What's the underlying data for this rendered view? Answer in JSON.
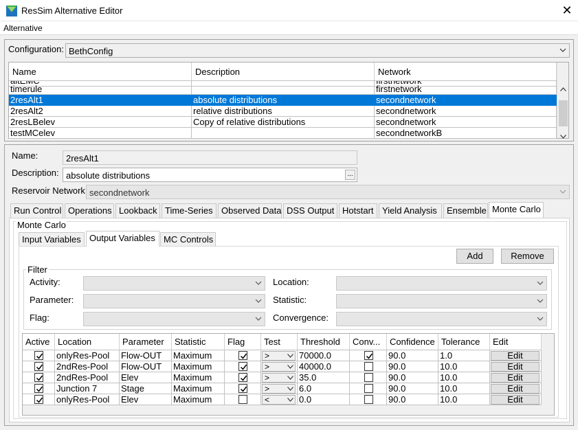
{
  "window": {
    "title": "ResSim Alternative Editor"
  },
  "menu": {
    "items": [
      "Alternative"
    ]
  },
  "configuration": {
    "label": "Configuration:",
    "value": "BethConfig"
  },
  "alt_table": {
    "columns": [
      "Name",
      "Description",
      "Network"
    ],
    "rows": [
      {
        "name": "altEMC",
        "description": "",
        "network": "firstnetwork"
      },
      {
        "name": "timerule",
        "description": "",
        "network": "firstnetwork"
      },
      {
        "name": "2resAlt1",
        "description": "absolute distributions",
        "network": "secondnetwork"
      },
      {
        "name": "2resAlt2",
        "description": "relative distributions",
        "network": "secondnetwork"
      },
      {
        "name": "2resLBelev",
        "description": "Copy of relative distributions",
        "network": "secondnetwork"
      },
      {
        "name": "testMCelev",
        "description": "",
        "network": "secondnetworkB"
      }
    ],
    "selected_index": 2
  },
  "details": {
    "name_label": "Name:",
    "name_value": "2resAlt1",
    "desc_label": "Description:",
    "desc_value": "absolute distributions",
    "desc_button": "...",
    "network_label": "Reservoir Network",
    "network_value": "secondnetwork"
  },
  "tabs": [
    "Run Control",
    "Operations",
    "Lookback",
    "Time-Series",
    "Observed Data",
    "DSS Output",
    "Hotstart",
    "Yield Analysis",
    "Ensemble",
    "Monte Carlo"
  ],
  "active_tab": "Monte Carlo",
  "monte_carlo": {
    "group_label": "Monte Carlo",
    "subtabs": [
      "Input Variables",
      "Output Variables",
      "MC Controls"
    ],
    "active_subtab": "Output Variables",
    "add_label": "Add",
    "remove_label": "Remove",
    "filter": {
      "label": "Filter",
      "activity_label": "Activity:",
      "location_label": "Location:",
      "parameter_label": "Parameter:",
      "statistic_label": "Statistic:",
      "flag_label": "Flag:",
      "convergence_label": "Convergence:"
    },
    "grid": {
      "columns": [
        "Active",
        "Location",
        "Parameter",
        "Statistic",
        "Flag",
        "Test",
        "Threshold",
        "Conv...",
        "Confidence",
        "Tolerance",
        "Edit"
      ],
      "rows": [
        {
          "active": true,
          "location": "onlyRes-Pool",
          "parameter": "Flow-OUT",
          "statistic": "Maximum",
          "flag": true,
          "test": ">",
          "threshold": "70000.0",
          "conv": true,
          "confidence": "90.0",
          "tolerance": "1.0",
          "edit": "Edit"
        },
        {
          "active": true,
          "location": "2ndRes-Pool",
          "parameter": "Flow-OUT",
          "statistic": "Maximum",
          "flag": true,
          "test": ">",
          "threshold": "40000.0",
          "conv": false,
          "confidence": "90.0",
          "tolerance": "10.0",
          "edit": "Edit"
        },
        {
          "active": true,
          "location": "2ndRes-Pool",
          "parameter": "Elev",
          "statistic": "Maximum",
          "flag": true,
          "test": ">",
          "threshold": "35.0",
          "conv": false,
          "confidence": "90.0",
          "tolerance": "10.0",
          "edit": "Edit"
        },
        {
          "active": true,
          "location": "Junction 7",
          "parameter": "Stage",
          "statistic": "Maximum",
          "flag": true,
          "test": ">",
          "threshold": "6.0",
          "conv": false,
          "confidence": "90.0",
          "tolerance": "10.0",
          "edit": "Edit"
        },
        {
          "active": true,
          "location": "onlyRes-Pool",
          "parameter": "Elev",
          "statistic": "Maximum",
          "flag": false,
          "test": "<",
          "threshold": "0.0",
          "conv": false,
          "confidence": "90.0",
          "tolerance": "10.0",
          "edit": "Edit"
        }
      ]
    }
  },
  "colors": {
    "selection": "#0078d7",
    "window_bg": "#f0f0f0"
  },
  "icons": {
    "app": "ressim-app-icon",
    "close": "close-icon",
    "dropdown": "chevron-down-icon",
    "check": "check-icon"
  }
}
